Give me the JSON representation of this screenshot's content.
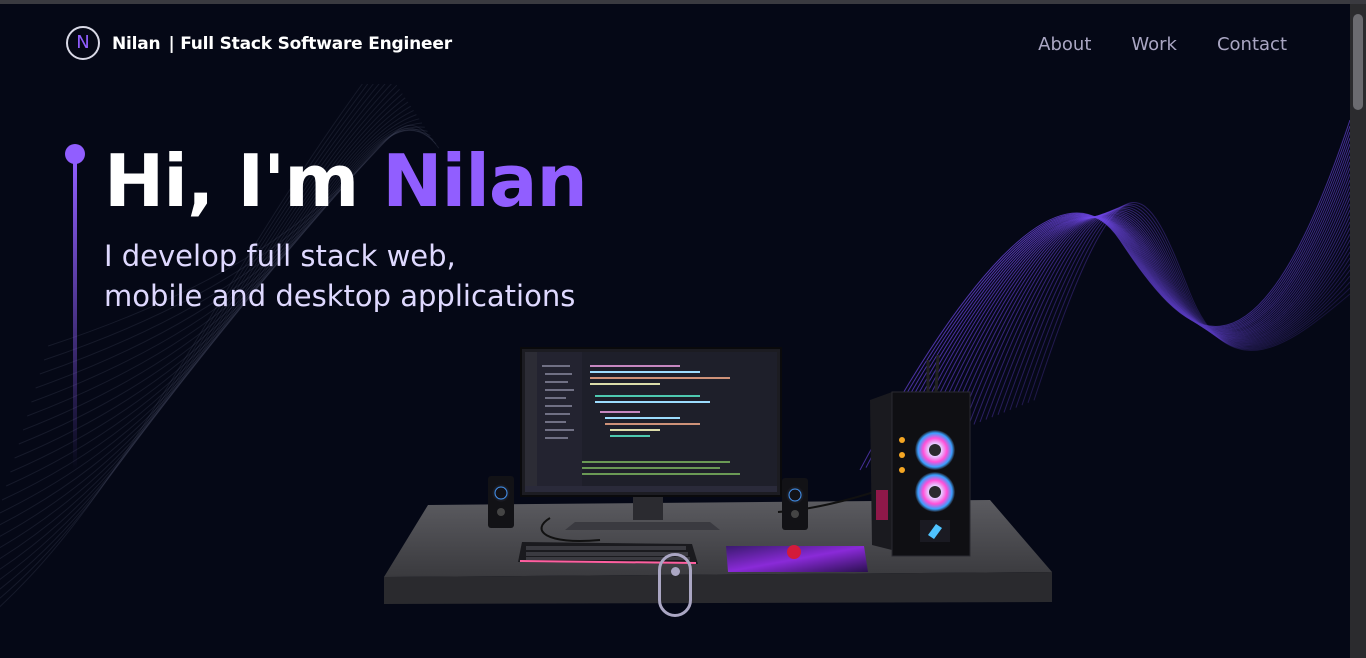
{
  "nav": {
    "logo_letter": "N",
    "brand_name": "Nilan",
    "brand_tagline": "| Full Stack Software Engineer",
    "links": [
      {
        "label": "About"
      },
      {
        "label": "Work"
      },
      {
        "label": "Contact"
      }
    ]
  },
  "hero": {
    "greeting": "Hi, I'm ",
    "name": "Nilan",
    "subtitle_line1": "I develop full stack web,",
    "subtitle_line2": "mobile and desktop applications"
  },
  "colors": {
    "background": "#050816",
    "accent": "#915eff",
    "nav_text": "#aaa6c3",
    "subtitle_text": "#dfd9ff"
  },
  "icons": {
    "logo": "logo-circle-icon",
    "scroll": "scroll-mouse-icon"
  }
}
